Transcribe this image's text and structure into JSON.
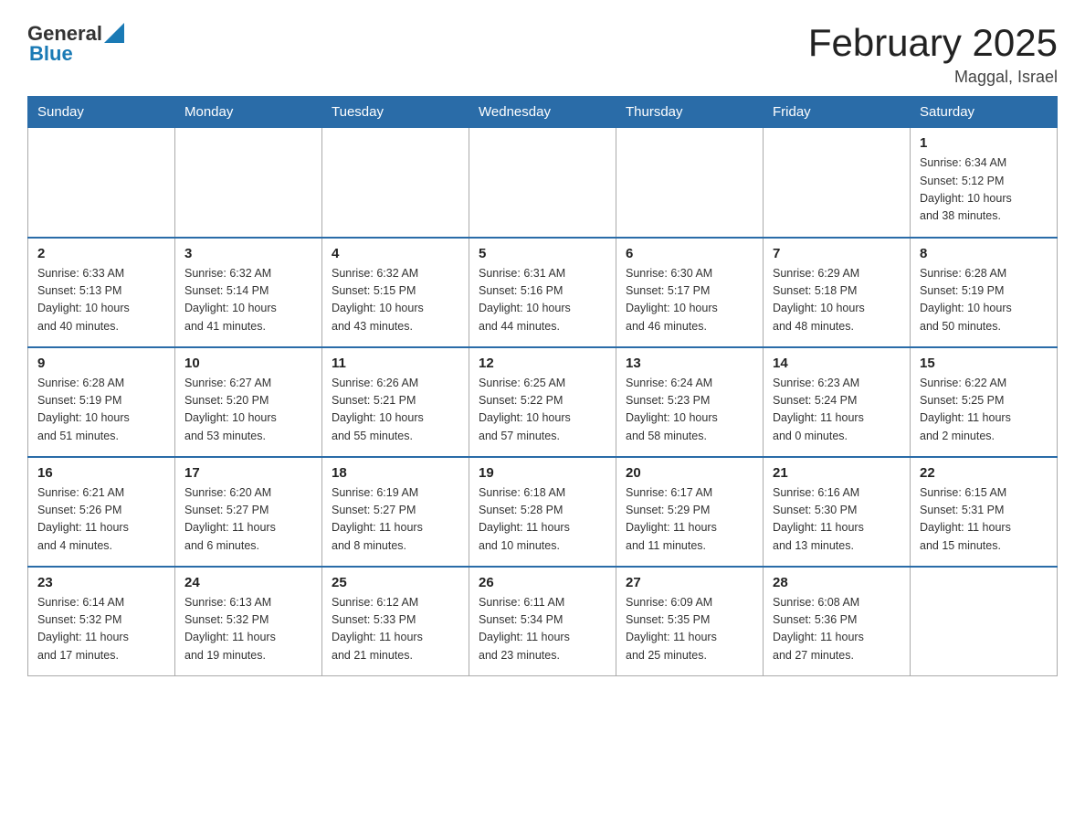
{
  "header": {
    "logo_general": "General",
    "logo_blue": "Blue",
    "title": "February 2025",
    "location": "Maggal, Israel"
  },
  "weekdays": [
    "Sunday",
    "Monday",
    "Tuesday",
    "Wednesday",
    "Thursday",
    "Friday",
    "Saturday"
  ],
  "weeks": [
    [
      {
        "day": "",
        "info": ""
      },
      {
        "day": "",
        "info": ""
      },
      {
        "day": "",
        "info": ""
      },
      {
        "day": "",
        "info": ""
      },
      {
        "day": "",
        "info": ""
      },
      {
        "day": "",
        "info": ""
      },
      {
        "day": "1",
        "info": "Sunrise: 6:34 AM\nSunset: 5:12 PM\nDaylight: 10 hours\nand 38 minutes."
      }
    ],
    [
      {
        "day": "2",
        "info": "Sunrise: 6:33 AM\nSunset: 5:13 PM\nDaylight: 10 hours\nand 40 minutes."
      },
      {
        "day": "3",
        "info": "Sunrise: 6:32 AM\nSunset: 5:14 PM\nDaylight: 10 hours\nand 41 minutes."
      },
      {
        "day": "4",
        "info": "Sunrise: 6:32 AM\nSunset: 5:15 PM\nDaylight: 10 hours\nand 43 minutes."
      },
      {
        "day": "5",
        "info": "Sunrise: 6:31 AM\nSunset: 5:16 PM\nDaylight: 10 hours\nand 44 minutes."
      },
      {
        "day": "6",
        "info": "Sunrise: 6:30 AM\nSunset: 5:17 PM\nDaylight: 10 hours\nand 46 minutes."
      },
      {
        "day": "7",
        "info": "Sunrise: 6:29 AM\nSunset: 5:18 PM\nDaylight: 10 hours\nand 48 minutes."
      },
      {
        "day": "8",
        "info": "Sunrise: 6:28 AM\nSunset: 5:19 PM\nDaylight: 10 hours\nand 50 minutes."
      }
    ],
    [
      {
        "day": "9",
        "info": "Sunrise: 6:28 AM\nSunset: 5:19 PM\nDaylight: 10 hours\nand 51 minutes."
      },
      {
        "day": "10",
        "info": "Sunrise: 6:27 AM\nSunset: 5:20 PM\nDaylight: 10 hours\nand 53 minutes."
      },
      {
        "day": "11",
        "info": "Sunrise: 6:26 AM\nSunset: 5:21 PM\nDaylight: 10 hours\nand 55 minutes."
      },
      {
        "day": "12",
        "info": "Sunrise: 6:25 AM\nSunset: 5:22 PM\nDaylight: 10 hours\nand 57 minutes."
      },
      {
        "day": "13",
        "info": "Sunrise: 6:24 AM\nSunset: 5:23 PM\nDaylight: 10 hours\nand 58 minutes."
      },
      {
        "day": "14",
        "info": "Sunrise: 6:23 AM\nSunset: 5:24 PM\nDaylight: 11 hours\nand 0 minutes."
      },
      {
        "day": "15",
        "info": "Sunrise: 6:22 AM\nSunset: 5:25 PM\nDaylight: 11 hours\nand 2 minutes."
      }
    ],
    [
      {
        "day": "16",
        "info": "Sunrise: 6:21 AM\nSunset: 5:26 PM\nDaylight: 11 hours\nand 4 minutes."
      },
      {
        "day": "17",
        "info": "Sunrise: 6:20 AM\nSunset: 5:27 PM\nDaylight: 11 hours\nand 6 minutes."
      },
      {
        "day": "18",
        "info": "Sunrise: 6:19 AM\nSunset: 5:27 PM\nDaylight: 11 hours\nand 8 minutes."
      },
      {
        "day": "19",
        "info": "Sunrise: 6:18 AM\nSunset: 5:28 PM\nDaylight: 11 hours\nand 10 minutes."
      },
      {
        "day": "20",
        "info": "Sunrise: 6:17 AM\nSunset: 5:29 PM\nDaylight: 11 hours\nand 11 minutes."
      },
      {
        "day": "21",
        "info": "Sunrise: 6:16 AM\nSunset: 5:30 PM\nDaylight: 11 hours\nand 13 minutes."
      },
      {
        "day": "22",
        "info": "Sunrise: 6:15 AM\nSunset: 5:31 PM\nDaylight: 11 hours\nand 15 minutes."
      }
    ],
    [
      {
        "day": "23",
        "info": "Sunrise: 6:14 AM\nSunset: 5:32 PM\nDaylight: 11 hours\nand 17 minutes."
      },
      {
        "day": "24",
        "info": "Sunrise: 6:13 AM\nSunset: 5:32 PM\nDaylight: 11 hours\nand 19 minutes."
      },
      {
        "day": "25",
        "info": "Sunrise: 6:12 AM\nSunset: 5:33 PM\nDaylight: 11 hours\nand 21 minutes."
      },
      {
        "day": "26",
        "info": "Sunrise: 6:11 AM\nSunset: 5:34 PM\nDaylight: 11 hours\nand 23 minutes."
      },
      {
        "day": "27",
        "info": "Sunrise: 6:09 AM\nSunset: 5:35 PM\nDaylight: 11 hours\nand 25 minutes."
      },
      {
        "day": "28",
        "info": "Sunrise: 6:08 AM\nSunset: 5:36 PM\nDaylight: 11 hours\nand 27 minutes."
      },
      {
        "day": "",
        "info": ""
      }
    ]
  ]
}
